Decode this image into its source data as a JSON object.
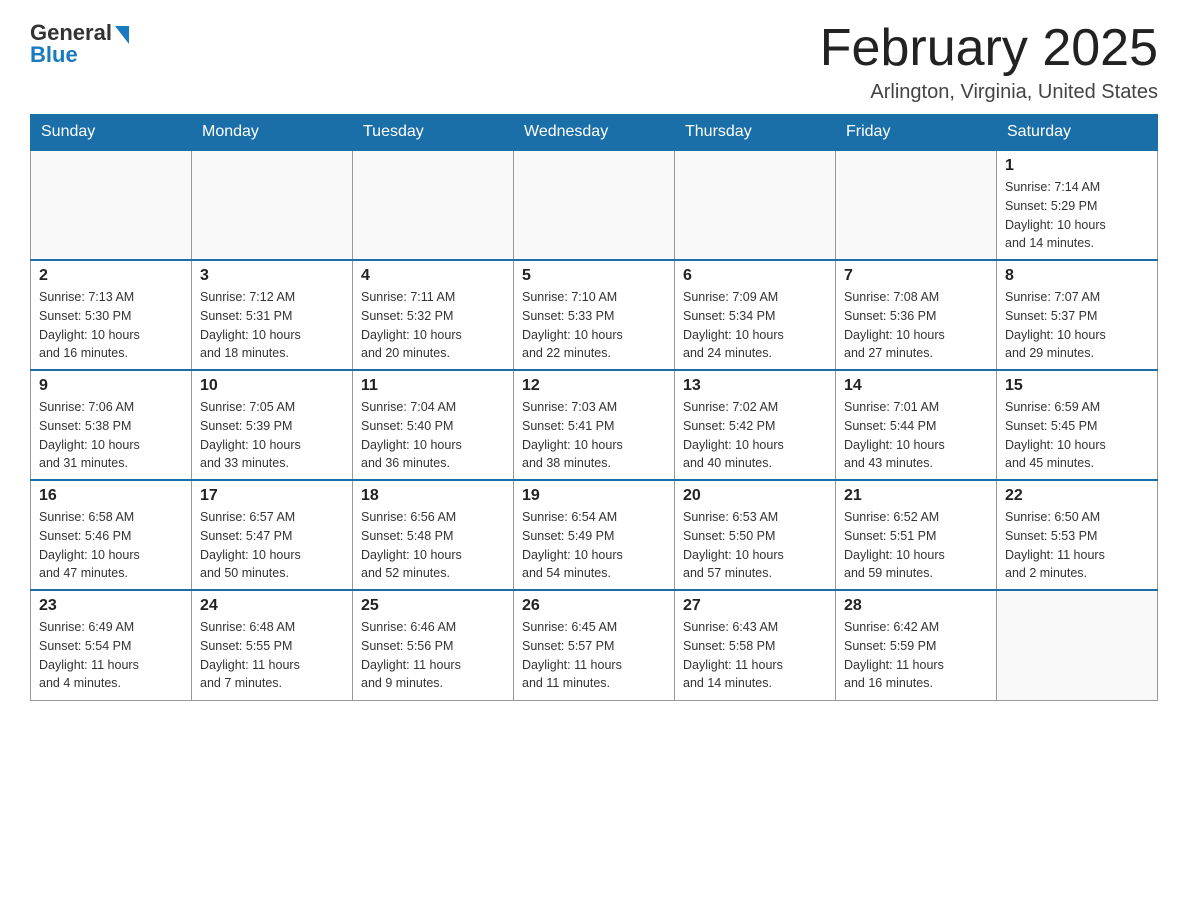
{
  "header": {
    "logo_general": "General",
    "logo_blue": "Blue",
    "month_title": "February 2025",
    "location": "Arlington, Virginia, United States"
  },
  "days_of_week": [
    "Sunday",
    "Monday",
    "Tuesday",
    "Wednesday",
    "Thursday",
    "Friday",
    "Saturday"
  ],
  "weeks": [
    [
      {
        "day": "",
        "info": ""
      },
      {
        "day": "",
        "info": ""
      },
      {
        "day": "",
        "info": ""
      },
      {
        "day": "",
        "info": ""
      },
      {
        "day": "",
        "info": ""
      },
      {
        "day": "",
        "info": ""
      },
      {
        "day": "1",
        "info": "Sunrise: 7:14 AM\nSunset: 5:29 PM\nDaylight: 10 hours\nand 14 minutes."
      }
    ],
    [
      {
        "day": "2",
        "info": "Sunrise: 7:13 AM\nSunset: 5:30 PM\nDaylight: 10 hours\nand 16 minutes."
      },
      {
        "day": "3",
        "info": "Sunrise: 7:12 AM\nSunset: 5:31 PM\nDaylight: 10 hours\nand 18 minutes."
      },
      {
        "day": "4",
        "info": "Sunrise: 7:11 AM\nSunset: 5:32 PM\nDaylight: 10 hours\nand 20 minutes."
      },
      {
        "day": "5",
        "info": "Sunrise: 7:10 AM\nSunset: 5:33 PM\nDaylight: 10 hours\nand 22 minutes."
      },
      {
        "day": "6",
        "info": "Sunrise: 7:09 AM\nSunset: 5:34 PM\nDaylight: 10 hours\nand 24 minutes."
      },
      {
        "day": "7",
        "info": "Sunrise: 7:08 AM\nSunset: 5:36 PM\nDaylight: 10 hours\nand 27 minutes."
      },
      {
        "day": "8",
        "info": "Sunrise: 7:07 AM\nSunset: 5:37 PM\nDaylight: 10 hours\nand 29 minutes."
      }
    ],
    [
      {
        "day": "9",
        "info": "Sunrise: 7:06 AM\nSunset: 5:38 PM\nDaylight: 10 hours\nand 31 minutes."
      },
      {
        "day": "10",
        "info": "Sunrise: 7:05 AM\nSunset: 5:39 PM\nDaylight: 10 hours\nand 33 minutes."
      },
      {
        "day": "11",
        "info": "Sunrise: 7:04 AM\nSunset: 5:40 PM\nDaylight: 10 hours\nand 36 minutes."
      },
      {
        "day": "12",
        "info": "Sunrise: 7:03 AM\nSunset: 5:41 PM\nDaylight: 10 hours\nand 38 minutes."
      },
      {
        "day": "13",
        "info": "Sunrise: 7:02 AM\nSunset: 5:42 PM\nDaylight: 10 hours\nand 40 minutes."
      },
      {
        "day": "14",
        "info": "Sunrise: 7:01 AM\nSunset: 5:44 PM\nDaylight: 10 hours\nand 43 minutes."
      },
      {
        "day": "15",
        "info": "Sunrise: 6:59 AM\nSunset: 5:45 PM\nDaylight: 10 hours\nand 45 minutes."
      }
    ],
    [
      {
        "day": "16",
        "info": "Sunrise: 6:58 AM\nSunset: 5:46 PM\nDaylight: 10 hours\nand 47 minutes."
      },
      {
        "day": "17",
        "info": "Sunrise: 6:57 AM\nSunset: 5:47 PM\nDaylight: 10 hours\nand 50 minutes."
      },
      {
        "day": "18",
        "info": "Sunrise: 6:56 AM\nSunset: 5:48 PM\nDaylight: 10 hours\nand 52 minutes."
      },
      {
        "day": "19",
        "info": "Sunrise: 6:54 AM\nSunset: 5:49 PM\nDaylight: 10 hours\nand 54 minutes."
      },
      {
        "day": "20",
        "info": "Sunrise: 6:53 AM\nSunset: 5:50 PM\nDaylight: 10 hours\nand 57 minutes."
      },
      {
        "day": "21",
        "info": "Sunrise: 6:52 AM\nSunset: 5:51 PM\nDaylight: 10 hours\nand 59 minutes."
      },
      {
        "day": "22",
        "info": "Sunrise: 6:50 AM\nSunset: 5:53 PM\nDaylight: 11 hours\nand 2 minutes."
      }
    ],
    [
      {
        "day": "23",
        "info": "Sunrise: 6:49 AM\nSunset: 5:54 PM\nDaylight: 11 hours\nand 4 minutes."
      },
      {
        "day": "24",
        "info": "Sunrise: 6:48 AM\nSunset: 5:55 PM\nDaylight: 11 hours\nand 7 minutes."
      },
      {
        "day": "25",
        "info": "Sunrise: 6:46 AM\nSunset: 5:56 PM\nDaylight: 11 hours\nand 9 minutes."
      },
      {
        "day": "26",
        "info": "Sunrise: 6:45 AM\nSunset: 5:57 PM\nDaylight: 11 hours\nand 11 minutes."
      },
      {
        "day": "27",
        "info": "Sunrise: 6:43 AM\nSunset: 5:58 PM\nDaylight: 11 hours\nand 14 minutes."
      },
      {
        "day": "28",
        "info": "Sunrise: 6:42 AM\nSunset: 5:59 PM\nDaylight: 11 hours\nand 16 minutes."
      },
      {
        "day": "",
        "info": ""
      }
    ]
  ]
}
